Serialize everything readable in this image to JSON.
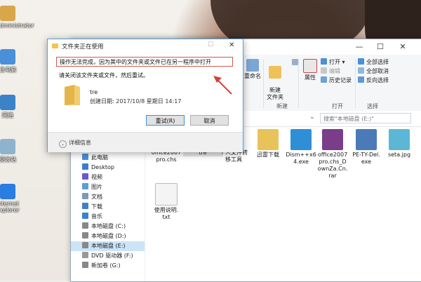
{
  "desktop": {
    "icons": [
      {
        "label": "Administrator",
        "name": "user-folder-icon",
        "color": "#d9a74a"
      },
      {
        "label": "此电脑",
        "name": "this-pc-icon",
        "color": "#4a90d9"
      },
      {
        "label": "网络",
        "name": "network-icon",
        "color": "#3b83c9"
      },
      {
        "label": "回收站",
        "name": "recycle-bin-icon",
        "color": "#8fb3cf"
      },
      {
        "label": "Internet Explorer",
        "name": "internet-explorer-icon",
        "color": "#2a7de1"
      }
    ]
  },
  "explorer": {
    "window_controls": {
      "minimize": "—",
      "maximize": "☐",
      "close": "✕"
    },
    "ribbon": {
      "rename": "重命名",
      "new_folder": "新建\n文件夹",
      "new_group": "新建",
      "new_item": "",
      "properties": "属性",
      "open": "打开",
      "edit": "编辑",
      "history": "历史记录",
      "open_group": "打开",
      "select_all": "全部选择",
      "select_none": "全部取消",
      "invert": "反向选择",
      "select_group": "选择"
    },
    "search_placeholder": "搜索\"本地磁盘 (E:)\"",
    "nav": [
      {
        "label": "此电脑",
        "name": "nav-this-pc"
      },
      {
        "label": "Desktop",
        "name": "nav-desktop"
      },
      {
        "label": "视频",
        "name": "nav-videos"
      },
      {
        "label": "图片",
        "name": "nav-pictures"
      },
      {
        "label": "文档",
        "name": "nav-documents"
      },
      {
        "label": "下载",
        "name": "nav-downloads"
      },
      {
        "label": "音乐",
        "name": "nav-music"
      },
      {
        "label": "本地磁盘 (C:)",
        "name": "nav-drive-c"
      },
      {
        "label": "本地磁盘 (D:)",
        "name": "nav-drive-d"
      },
      {
        "label": "本地磁盘 (E:)",
        "name": "nav-drive-e"
      },
      {
        "label": "DVD 驱动器 (F:)",
        "name": "nav-dvd-f"
      },
      {
        "label": "新加卷 (G:)",
        "name": "nav-volume-g"
      }
    ],
    "files": [
      {
        "label": "office2007\npro.chs",
        "name": "file-office2007-chs",
        "color": "#e9d9a0"
      },
      {
        "label": "tre",
        "name": "file-tre",
        "color": "#e8c35a"
      },
      {
        "label": "个人文件转\n移工具",
        "name": "file-migration-tool",
        "color": "#e8c35a"
      },
      {
        "label": "迅雷下载",
        "name": "file-thunder-download",
        "color": "#e8c35a"
      },
      {
        "label": "Dism++x6\n4.exe",
        "name": "file-dism-exe",
        "color": "#2f8fd6"
      },
      {
        "label": "office2007\npro.chs_D\nownZa.Cn.\nrar",
        "name": "file-office-rar",
        "color": "#7a3d8a"
      },
      {
        "label": "PE-TY-Del.\nexe",
        "name": "file-pe-ty-exe",
        "color": "#4a7ab8"
      },
      {
        "label": "seta.jpg",
        "name": "file-seta-jpg",
        "color": "#5cb6d6"
      },
      {
        "label": "使用说明.\ntxt",
        "name": "file-readme-txt",
        "color": "#f4f4f4"
      }
    ]
  },
  "dialog": {
    "title": "文件夹正在使用",
    "message": "操作无法完成，因为其中的文件夹或文件已在另一程序中打开",
    "instruction": "请关闭该文件夹或文件，然后重试。",
    "folder_name": "tre",
    "created": "创建日期: 2017/10/8 星期日 14:17",
    "retry": "重试(R)",
    "cancel": "取消",
    "details": "详细信息",
    "close": "✕",
    "maximize": "☐"
  },
  "colors": {
    "highlight_border": "#d05a4a",
    "arrow": "#d0443a",
    "selection": "#cce4f7"
  }
}
